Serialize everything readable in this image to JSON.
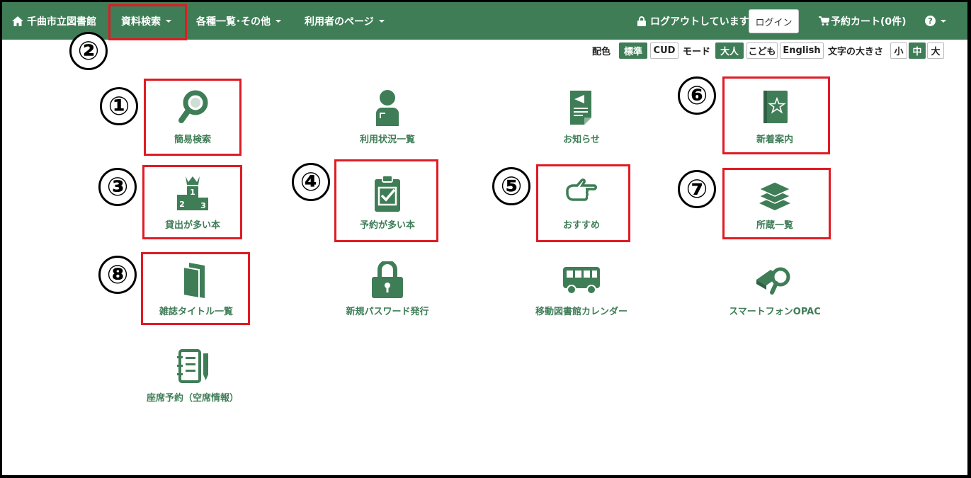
{
  "navbar": {
    "home": "千曲市立図書館",
    "menu1": "資料検索",
    "menu2": "各種一覧･その他",
    "menu3": "利用者のページ",
    "logout_status": "ログアウトしています",
    "login_button": "ログイン",
    "cart": "予約カート(0件)"
  },
  "settings": {
    "color_label": "配色",
    "color_standard": "標準",
    "color_cud": "CUD",
    "mode_label": "モード",
    "mode_adult": "大人",
    "mode_child": "こども",
    "mode_english": "English",
    "size_label": "文字の大きさ",
    "size_small": "小",
    "size_medium": "中",
    "size_large": "大"
  },
  "tiles": [
    {
      "label": "簡易検索",
      "icon": "magnifier-icon"
    },
    {
      "label": "利用状況一覧",
      "icon": "user-icon"
    },
    {
      "label": "お知らせ",
      "icon": "notice-icon"
    },
    {
      "label": "新着案内",
      "icon": "new-book-icon"
    },
    {
      "label": "貸出が多い本",
      "icon": "podium-icon"
    },
    {
      "label": "予約が多い本",
      "icon": "clipboard-check-icon"
    },
    {
      "label": "おすすめ",
      "icon": "pointing-hand-icon"
    },
    {
      "label": "所蔵一覧",
      "icon": "book-stack-icon"
    },
    {
      "label": "雑誌タイトル一覧",
      "icon": "magazine-icon"
    },
    {
      "label": "新規パスワード発行",
      "icon": "padlock-icon"
    },
    {
      "label": "移動図書館カレンダー",
      "icon": "bus-icon"
    },
    {
      "label": "スマートフォンOPAC",
      "icon": "book-search-icon"
    },
    {
      "label": "座席予約（空席情報）",
      "icon": "notebook-pen-icon"
    }
  ],
  "badges": [
    "①",
    "②",
    "③",
    "④",
    "⑤",
    "⑥",
    "⑦",
    "⑧"
  ],
  "colors": {
    "brand": "#3f7d57",
    "highlight": "#e01b24"
  }
}
